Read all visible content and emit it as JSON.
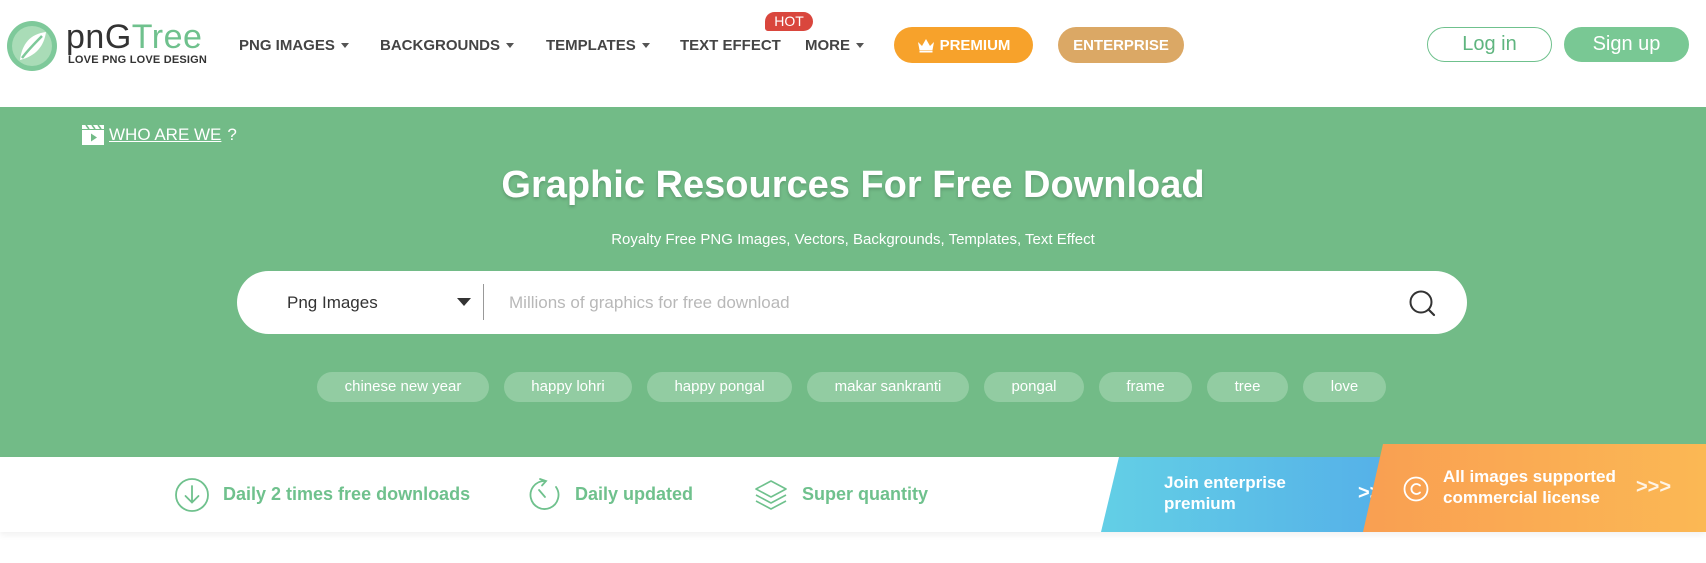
{
  "brand": {
    "name_part1": "pnG",
    "name_part2": "Tree",
    "tagline": "LOVE PNG LOVE DESIGN",
    "color_green": "#6fc18d"
  },
  "nav": {
    "items": [
      {
        "label": "PNG IMAGES",
        "has_dropdown": true
      },
      {
        "label": "BACKGROUNDS",
        "has_dropdown": true
      },
      {
        "label": "TEMPLATES",
        "has_dropdown": true
      },
      {
        "label": "TEXT EFFECT",
        "has_dropdown": false
      },
      {
        "label": "MORE",
        "has_dropdown": true
      }
    ],
    "hot_badge": "HOT",
    "premium_label": "PREMIUM",
    "premium_icon": "crown-icon",
    "enterprise_label": "ENTERPRISE",
    "login_label": "Log in",
    "signup_label": "Sign up"
  },
  "hero": {
    "who_link": "WHO ARE WE",
    "who_suffix": "?",
    "title": "Graphic Resources For Free Download",
    "subtitle": "Royalty Free PNG Images, Vectors, Backgrounds, Templates, Text Effect",
    "background_color": "#72bb87"
  },
  "search": {
    "type_selected": "Png Images",
    "placeholder": "Millions of graphics for free download",
    "value": ""
  },
  "tags": [
    "chinese new year",
    "happy lohri",
    "happy pongal",
    "makar sankranti",
    "pongal",
    "frame",
    "tree",
    "love"
  ],
  "features": [
    {
      "label": "Daily 2 times free downloads",
      "icon": "download-circle-icon"
    },
    {
      "label": "Daily updated",
      "icon": "clock-icon"
    },
    {
      "label": "Super quantity",
      "icon": "layers-icon"
    }
  ],
  "promos": {
    "enterprise": {
      "line1": "Join enterprise",
      "line2": "premium",
      "arrow": ">>"
    },
    "license": {
      "line1": "All images supported",
      "line2": "commercial license",
      "arrow": ">>>",
      "icon": "copyright-icon"
    }
  }
}
